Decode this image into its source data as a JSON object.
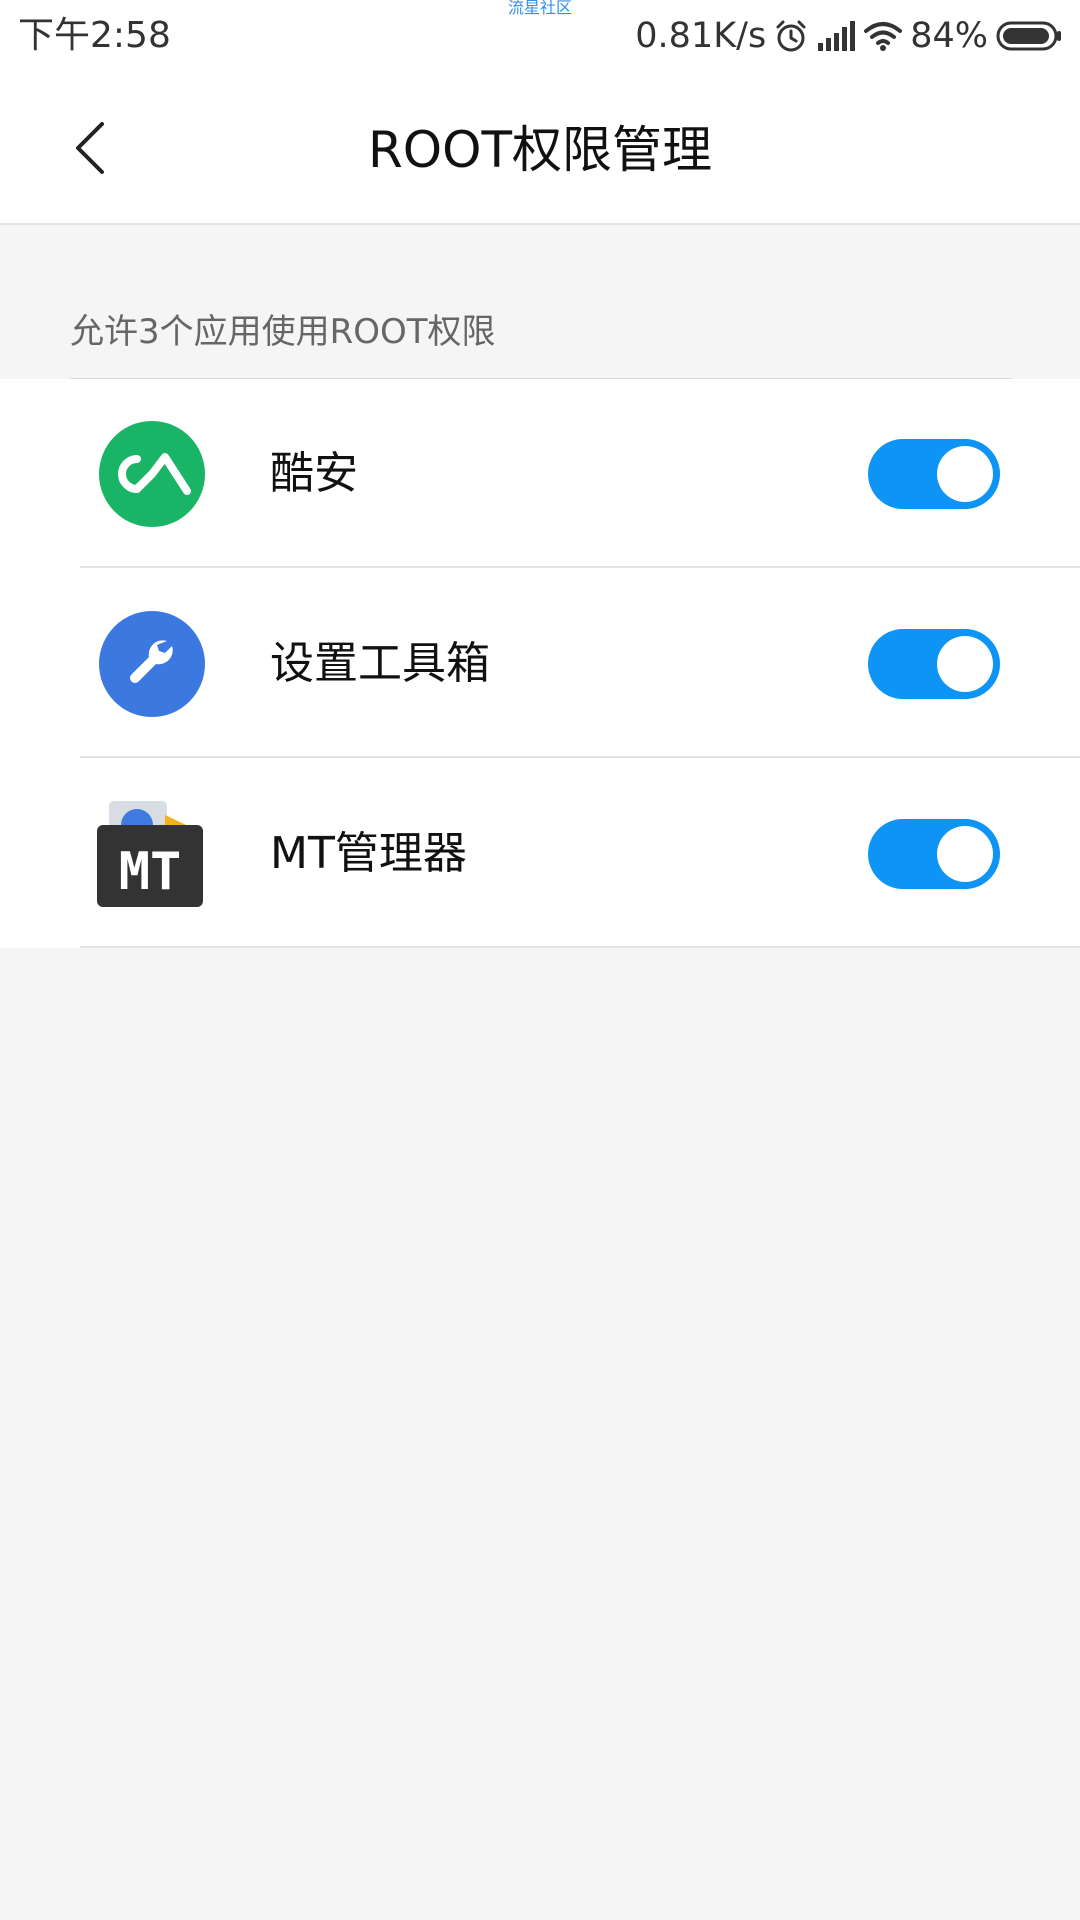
{
  "status_bar": {
    "time": "下午2:58",
    "watermark": "流星社区",
    "network_speed": "0.81K/s",
    "battery": "84%",
    "icons": [
      "alarm-icon",
      "signal-icon",
      "wifi-icon",
      "battery-icon"
    ]
  },
  "header": {
    "title": "ROOT权限管理",
    "back_icon": "chevron-left-icon"
  },
  "section": {
    "title": "允许3个应用使用ROOT权限"
  },
  "apps": [
    {
      "name": "酷安",
      "icon": "coolapk-icon",
      "enabled": true
    },
    {
      "name": "设置工具箱",
      "icon": "wrench-icon",
      "enabled": true
    },
    {
      "name": "MT管理器",
      "icon": "mt-manager-icon",
      "icon_text": "MT",
      "enabled": true
    }
  ],
  "colors": {
    "accent": "#0d94f5",
    "coolapk_green": "#19b466",
    "toolbox_blue": "#3b78e0",
    "background": "#f5f5f5"
  }
}
